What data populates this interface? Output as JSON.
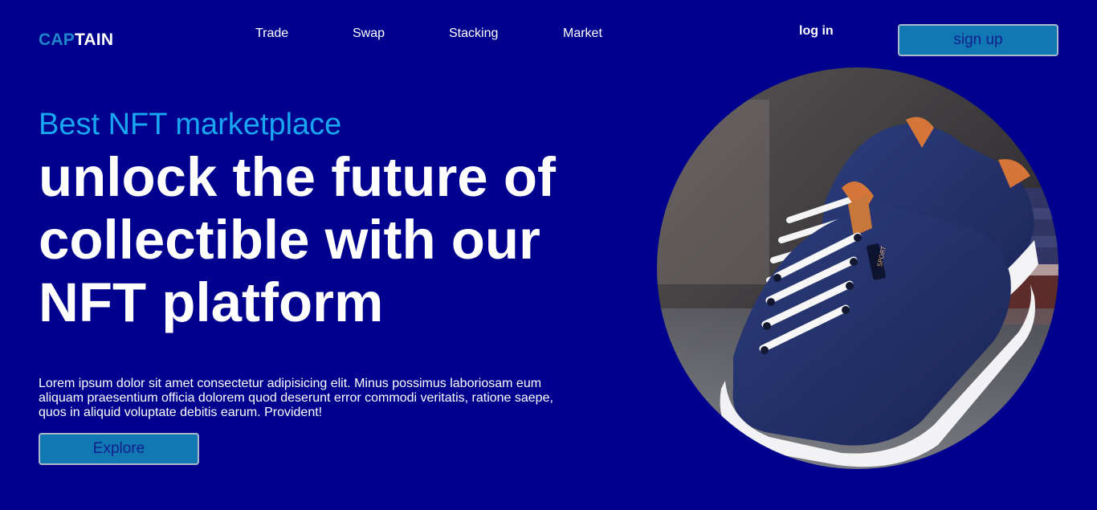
{
  "header": {
    "logo_part1": "CAP",
    "logo_part2": "TAIN",
    "nav": [
      {
        "label": "Trade"
      },
      {
        "label": "Swap"
      },
      {
        "label": "Stacking"
      },
      {
        "label": "Market"
      }
    ],
    "login_label": "log in",
    "signup_label": "sign up"
  },
  "hero": {
    "eyebrow": "Best NFT marketplace",
    "headline_line1": "unlock the future of",
    "headline_line2": "collectible with our",
    "headline_line3": "NFT platform",
    "description": "Lorem ipsum dolor sit amet consectetur adipisicing elit. Minus possimus laboriosam eum aliquam praesentium officia dolorem quod deserunt error commodi veritatis, ratione saepe, quos in aliquid voluptate debitis earum. Provident!",
    "explore_label": "Explore",
    "image": {
      "subject": "sneaker-photo",
      "shoe_tag_text": "SPORT"
    }
  },
  "colors": {
    "background": "#00008e",
    "accent_light": "#19a6f0",
    "logo_accent": "#1f86c9",
    "button_fill": "#1178b3",
    "button_text": "#10208e"
  }
}
